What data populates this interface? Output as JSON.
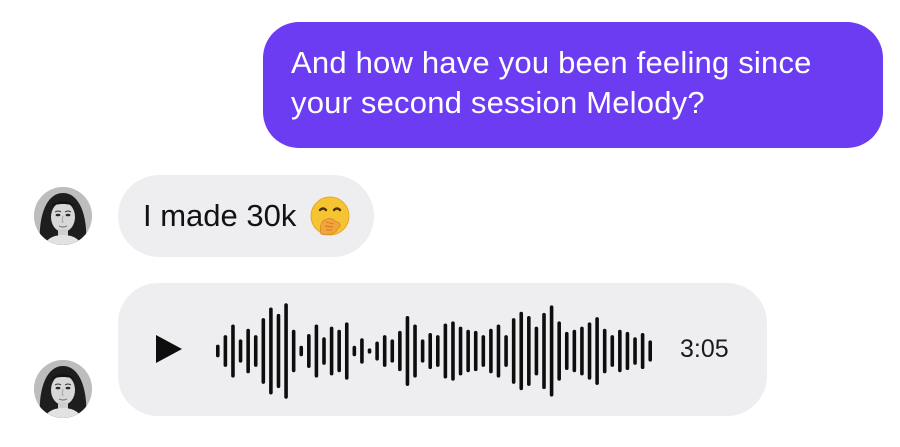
{
  "messages": {
    "outgoing": {
      "line1": "And how have you been feeling since",
      "line2": "your second session Melody?"
    },
    "incoming_text": {
      "text": "I made 30k",
      "emoji": "face-with-hand-over-mouth-icon"
    },
    "voice_note": {
      "duration": "3:05",
      "play_icon": "play-icon",
      "waveform_levels": [
        0.12,
        0.3,
        0.5,
        0.22,
        0.42,
        0.3,
        0.62,
        0.82,
        0.7,
        0.9,
        0.4,
        0.1,
        0.32,
        0.5,
        0.26,
        0.46,
        0.4,
        0.54,
        0.1,
        0.24,
        0.05,
        0.18,
        0.3,
        0.22,
        0.38,
        0.66,
        0.5,
        0.22,
        0.34,
        0.3,
        0.52,
        0.56,
        0.46,
        0.4,
        0.38,
        0.3,
        0.42,
        0.5,
        0.3,
        0.62,
        0.74,
        0.66,
        0.46,
        0.72,
        0.86,
        0.56,
        0.36,
        0.4,
        0.46,
        0.54,
        0.64,
        0.42,
        0.3,
        0.4,
        0.36,
        0.26,
        0.34,
        0.2
      ]
    }
  },
  "colors": {
    "outgoing_bubble": "#6c3cf2",
    "incoming_bubble": "#eeeef1",
    "text_dark": "#121212"
  }
}
